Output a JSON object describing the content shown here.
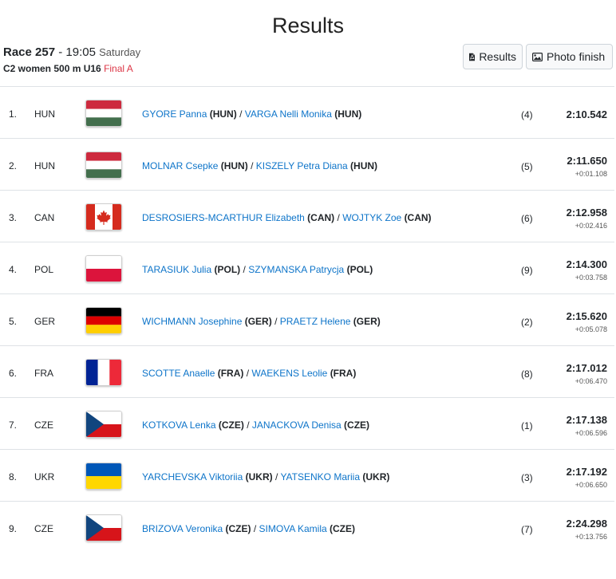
{
  "page": {
    "title": "Results"
  },
  "race": {
    "label": "Race 257",
    "separator": "-",
    "time": "19:05",
    "day": "Saturday",
    "event": "C2 women 500 m U16",
    "phase": "Final A"
  },
  "buttons": {
    "results_label": "Results",
    "photo_label": "Photo finish"
  },
  "rows": [
    {
      "pos": "1.",
      "nat": "HUN",
      "flag": "hungary-flag",
      "a1": "GYORE Panna",
      "c1": "(HUN)",
      "sep": "/",
      "a2": "VARGA Nelli Monika",
      "c2": "(HUN)",
      "lane": "(4)",
      "time": "2:10.542",
      "diff": ""
    },
    {
      "pos": "2.",
      "nat": "HUN",
      "flag": "hungary-flag",
      "a1": "MOLNAR Csepke",
      "c1": "(HUN)",
      "sep": "/",
      "a2": "KISZELY Petra Diana",
      "c2": "(HUN)",
      "lane": "(5)",
      "time": "2:11.650",
      "diff": "+0:01.108"
    },
    {
      "pos": "3.",
      "nat": "CAN",
      "flag": "canada-flag",
      "a1": "DESROSIERS-MCARTHUR Elizabeth",
      "c1": "(CAN)",
      "sep": "/",
      "a2": "WOJTYK Zoe",
      "c2": "(CAN)",
      "lane": "(6)",
      "time": "2:12.958",
      "diff": "+0:02.416"
    },
    {
      "pos": "4.",
      "nat": "POL",
      "flag": "poland-flag",
      "a1": "TARASIUK Julia",
      "c1": "(POL)",
      "sep": "/",
      "a2": "SZYMANSKA Patrycja",
      "c2": "(POL)",
      "lane": "(9)",
      "time": "2:14.300",
      "diff": "+0:03.758"
    },
    {
      "pos": "5.",
      "nat": "GER",
      "flag": "germany-flag",
      "a1": "WICHMANN Josephine",
      "c1": "(GER)",
      "sep": "/",
      "a2": "PRAETZ Helene",
      "c2": "(GER)",
      "lane": "(2)",
      "time": "2:15.620",
      "diff": "+0:05.078"
    },
    {
      "pos": "6.",
      "nat": "FRA",
      "flag": "france-flag",
      "a1": "SCOTTE Anaelle",
      "c1": "(FRA)",
      "sep": "/",
      "a2": "WAEKENS Leolie",
      "c2": "(FRA)",
      "lane": "(8)",
      "time": "2:17.012",
      "diff": "+0:06.470"
    },
    {
      "pos": "7.",
      "nat": "CZE",
      "flag": "czech-flag",
      "a1": "KOTKOVA Lenka",
      "c1": "(CZE)",
      "sep": "/",
      "a2": "JANACKOVA Denisa",
      "c2": "(CZE)",
      "lane": "(1)",
      "time": "2:17.138",
      "diff": "+0:06.596"
    },
    {
      "pos": "8.",
      "nat": "UKR",
      "flag": "ukraine-flag",
      "a1": "YARCHEVSKA Viktoriia",
      "c1": "(UKR)",
      "sep": "/",
      "a2": "YATSENKO Mariia",
      "c2": "(UKR)",
      "lane": "(3)",
      "time": "2:17.192",
      "diff": "+0:06.650"
    },
    {
      "pos": "9.",
      "nat": "CZE",
      "flag": "czech-flag",
      "a1": "BRIZOVA Veronika",
      "c1": "(CZE)",
      "sep": "/",
      "a2": "SIMOVA Kamila",
      "c2": "(CZE)",
      "lane": "(7)",
      "time": "2:24.298",
      "diff": "+0:13.756"
    }
  ],
  "colors": {
    "link": "#0d74c9",
    "final": "#dc3545"
  }
}
